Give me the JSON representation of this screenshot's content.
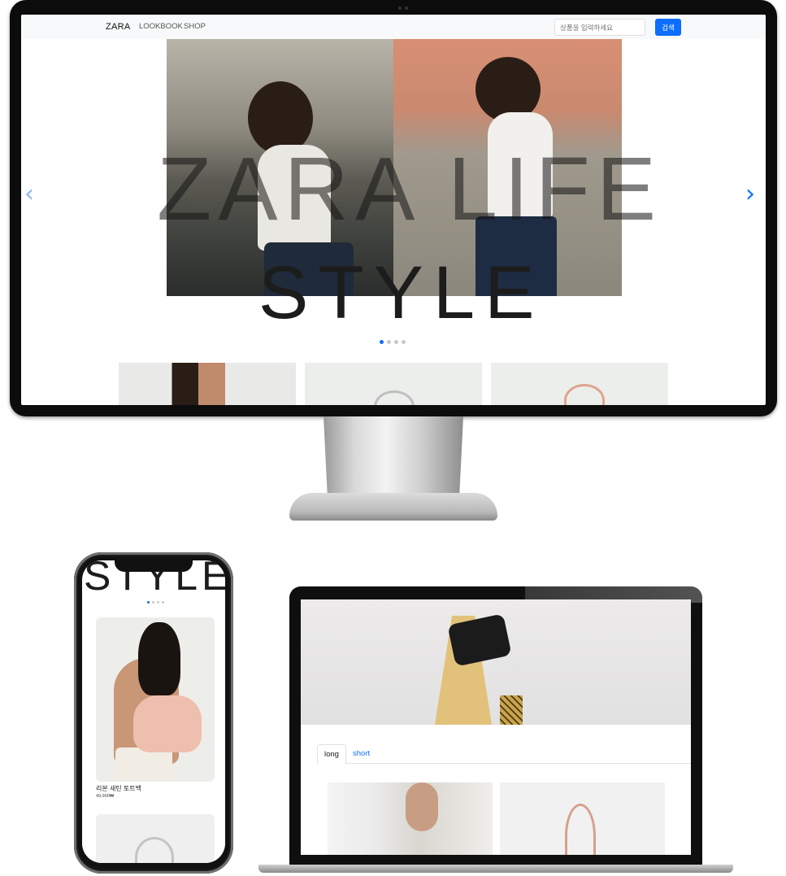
{
  "desktop": {
    "nav": {
      "brand": "ZARA",
      "links": [
        "LOOKBOOK",
        "SHOP"
      ],
      "search_placeholder": "상품을 입력하세요",
      "search_button": "검색"
    },
    "hero": {
      "overlay_line1": "ZARA LIFE",
      "overlay_line2": "STYLE",
      "prev_icon": "chevron-left-icon",
      "next_icon": "chevron-right-icon",
      "slides": 4,
      "active_slide": 1
    },
    "colors": {
      "accent": "#0d6efd",
      "navbar_bg": "#f8f9fa"
    }
  },
  "phone": {
    "hero_word": "STYLE",
    "product": {
      "name": "리본 새틴 토트백",
      "price": "49,900₩"
    }
  },
  "laptop": {
    "tabs": [
      {
        "label": "long",
        "active": true
      },
      {
        "label": "short",
        "active": false
      }
    ]
  }
}
